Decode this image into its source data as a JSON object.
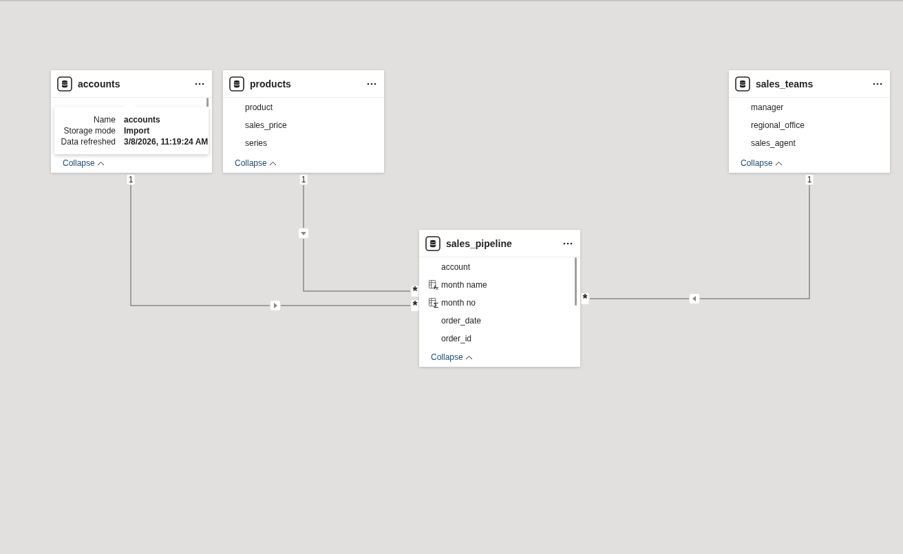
{
  "tables": [
    {
      "name": "accounts",
      "collapse_label": "Collapse",
      "tooltip": {
        "rows": [
          {
            "label": "Name",
            "value": "accounts"
          },
          {
            "label": "Storage mode",
            "value": "Import"
          },
          {
            "label": "Data refreshed",
            "value": "3/8/2026, 11:19:24 AM"
          }
        ]
      }
    },
    {
      "name": "products",
      "fields": [
        {
          "name": "product",
          "kind": "column"
        },
        {
          "name": "sales_price",
          "kind": "column"
        },
        {
          "name": "series",
          "kind": "column"
        }
      ],
      "collapse_label": "Collapse"
    },
    {
      "name": "sales_teams",
      "fields": [
        {
          "name": "manager",
          "kind": "column"
        },
        {
          "name": "regional_office",
          "kind": "column"
        },
        {
          "name": "sales_agent",
          "kind": "column"
        }
      ],
      "collapse_label": "Collapse"
    },
    {
      "name": "sales_pipeline",
      "fields": [
        {
          "name": "account",
          "kind": "column"
        },
        {
          "name": "month name",
          "kind": "calculated"
        },
        {
          "name": "month no",
          "kind": "sigma"
        },
        {
          "name": "order_date",
          "kind": "column"
        },
        {
          "name": "order_id",
          "kind": "column"
        }
      ],
      "collapse_label": "Collapse"
    }
  ],
  "relationships": [
    {
      "one_label": "1",
      "many_label": "*",
      "single_direction_filter": true
    },
    {
      "one_label": "1",
      "many_label": "*",
      "single_direction_filter": true
    },
    {
      "one_label": "1",
      "many_label": "*",
      "single_direction_filter": true
    }
  ]
}
